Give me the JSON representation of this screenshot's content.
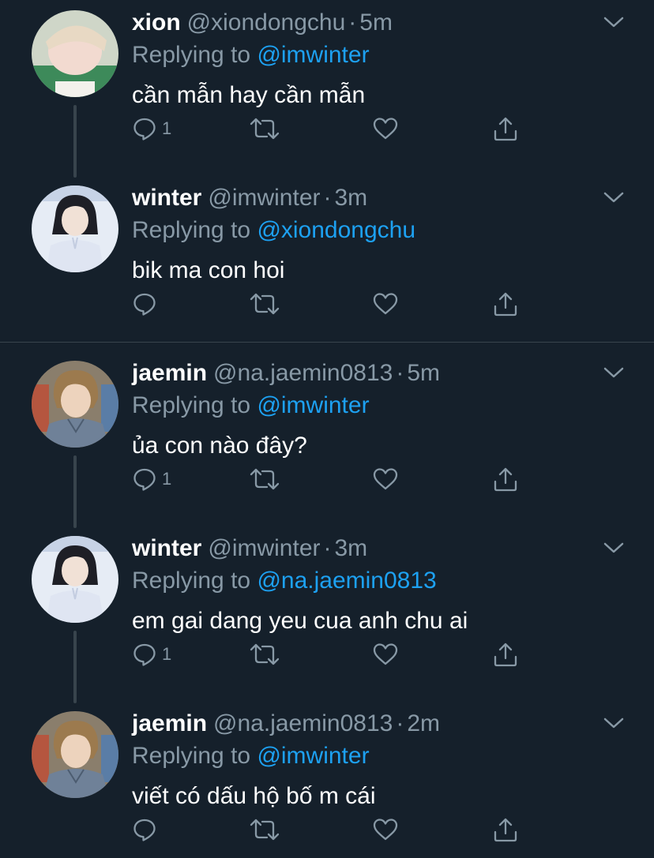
{
  "tweets": [
    {
      "name": "xion",
      "handle": "@xiondongchu",
      "dot": "·",
      "time": "5m",
      "replying_prefix": "Replying to",
      "replying_to": "@imwinter",
      "text": "cần mẫn hay cần mẫn",
      "reply_count": "1"
    },
    {
      "name": "winter",
      "handle": "@imwinter",
      "dot": "·",
      "time": "3m",
      "replying_prefix": "Replying to",
      "replying_to": "@xiondongchu",
      "text": "bik ma con hoi",
      "reply_count": ""
    },
    {
      "name": "jaemin",
      "handle": "@na.jaemin0813",
      "dot": "·",
      "time": "5m",
      "replying_prefix": "Replying to",
      "replying_to": "@imwinter",
      "text": "ủa con nào đây?",
      "reply_count": "1"
    },
    {
      "name": "winter",
      "handle": "@imwinter",
      "dot": "·",
      "time": "3m",
      "replying_prefix": "Replying to",
      "replying_to": "@na.jaemin0813",
      "text": "em gai dang yeu cua anh chu ai",
      "reply_count": "1"
    },
    {
      "name": "jaemin",
      "handle": "@na.jaemin0813",
      "dot": "·",
      "time": "2m",
      "replying_prefix": "Replying to",
      "replying_to": "@imwinter",
      "text": "viết có dấu hộ bố m cái",
      "reply_count": ""
    }
  ],
  "icons": {
    "reply": "reply-icon",
    "retweet": "retweet-icon",
    "like": "heart-icon",
    "share": "share-icon",
    "more": "chevron-down-icon"
  },
  "colors": {
    "background": "#15202b",
    "secondary_text": "#8899a6",
    "link": "#1da1f2",
    "divider": "#38444d"
  }
}
